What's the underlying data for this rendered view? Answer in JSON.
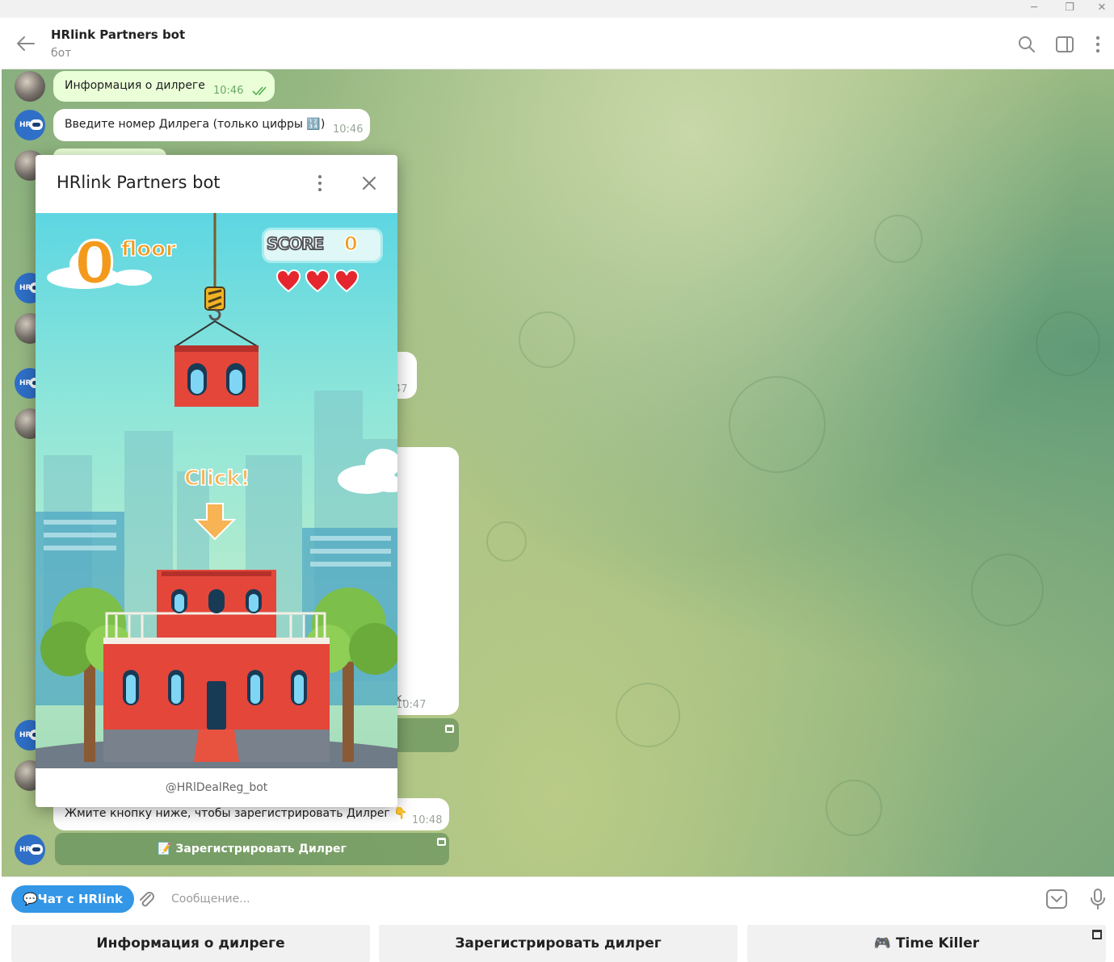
{
  "window": {
    "minimize_glyph": "─",
    "restore_glyph": "❐",
    "close_glyph": "✕"
  },
  "header": {
    "title": "HRlink Partners bot",
    "status": "бот",
    "icons": [
      "back-arrow-icon",
      "search-icon",
      "sidebar-toggle-icon",
      "more-vertical-icon"
    ]
  },
  "messages": [
    {
      "type": "out",
      "text": "Информация о дилреге",
      "time": "10:46",
      "read": true
    },
    {
      "type": "in",
      "text": "Введите номер Дилрега (только цифры 🔢)",
      "time": "10:46"
    },
    {
      "type": "in",
      "text": "",
      "time": "10:47",
      "partial": "47"
    },
    {
      "type": "in",
      "text": "",
      "time": "10:47",
      "partial": "ĸ."
    },
    {
      "type": "in",
      "text": "Жмите кнопку ниже, чтобы зарегистрировать Дилрег 👇",
      "time": "10:48"
    }
  ],
  "inline_button": {
    "label": "📝 Зарегистрировать Дилрег"
  },
  "miniapp": {
    "title": "HRlink Partners bot",
    "footer": "@HRlDealReg_bot",
    "game": {
      "floor_number": "0",
      "floor_label": "floor",
      "score_label": "SCORE",
      "score_value": "0",
      "lives": 3,
      "prompt": "Click!"
    }
  },
  "composer": {
    "chip_label": "💬Чат с HRlink",
    "placeholder": "Сообщение..."
  },
  "keyboard": {
    "buttons": [
      "Информация о дилреге",
      "Зарегистрировать дилрег",
      "🎮 Time Killer"
    ]
  },
  "colors": {
    "accent": "#3396e6",
    "outgoing_bubble": "#eaffd8",
    "game_orange": "#f39a1c"
  }
}
